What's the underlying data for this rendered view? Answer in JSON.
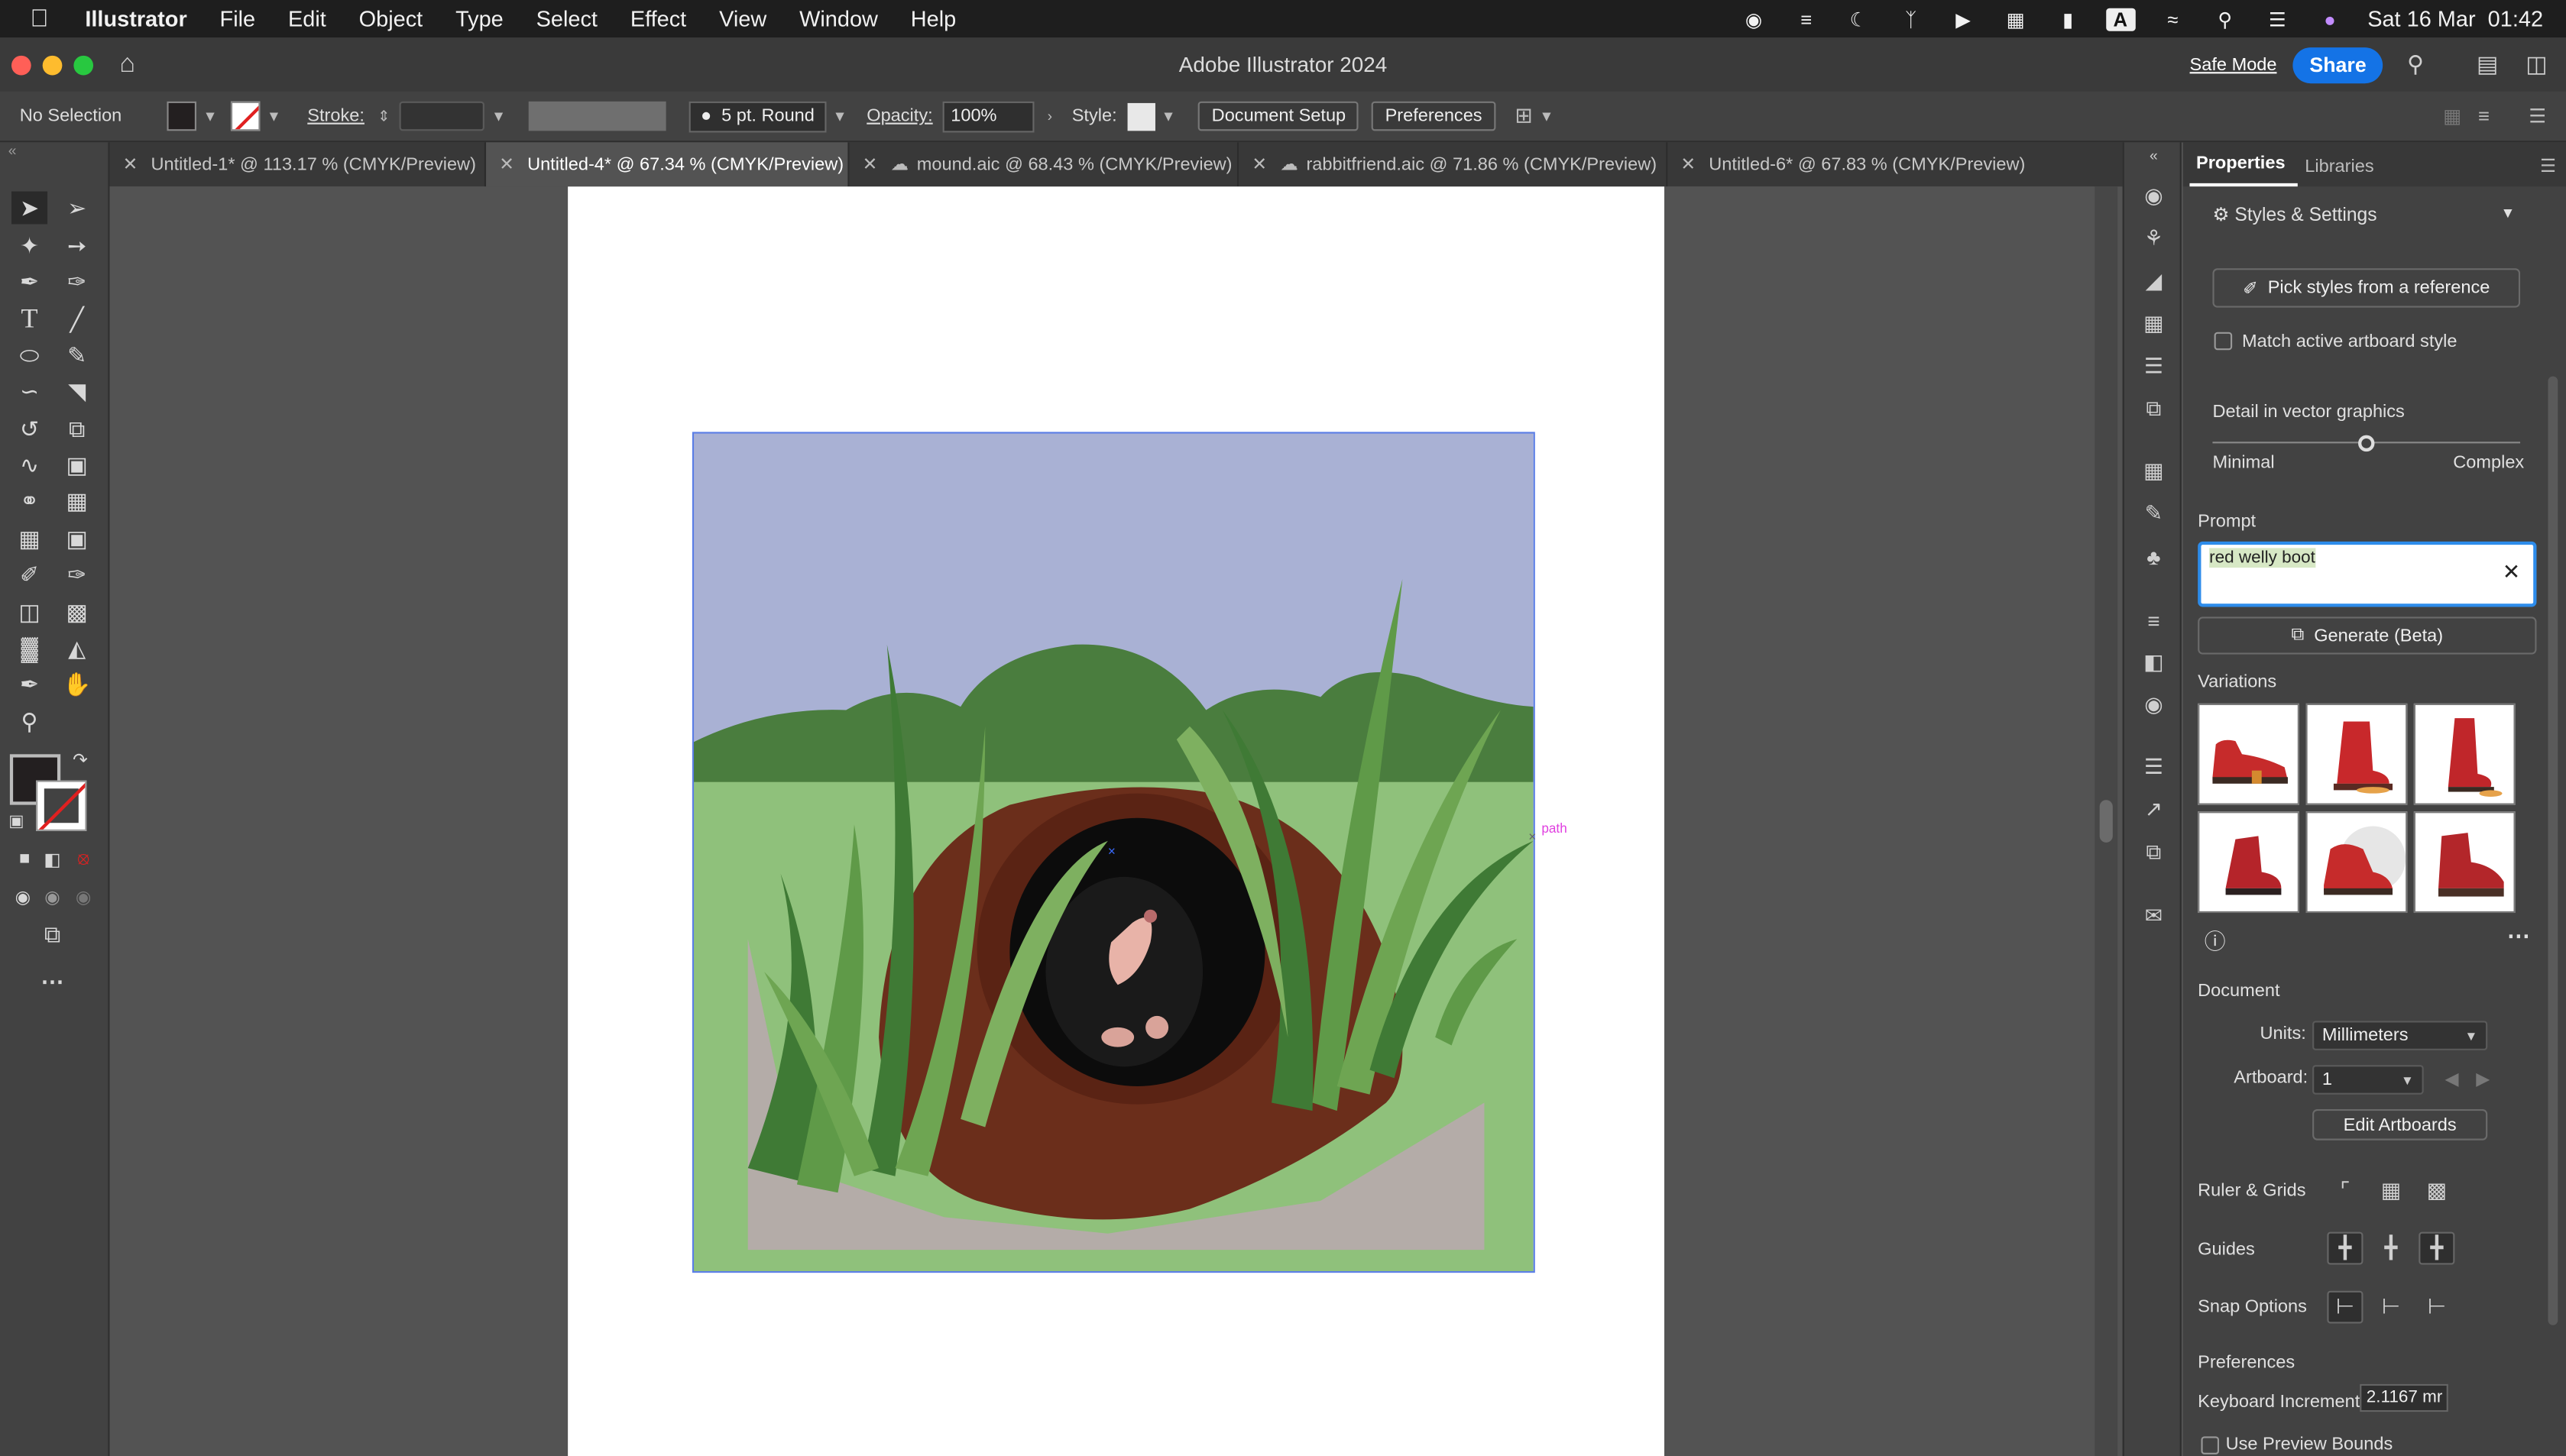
{
  "menubar": {
    "app_name": "Illustrator",
    "items": [
      "File",
      "Edit",
      "Object",
      "Type",
      "Select",
      "Effect",
      "View",
      "Window",
      "Help"
    ],
    "datetime": "Sat 16 Mar  01:42",
    "status_icons": [
      "creative-cloud-icon",
      "drive-icon",
      "moon-icon",
      "bluetooth-icon",
      "play-icon",
      "memory-icon",
      "battery-icon",
      "text-input-icon",
      "wifi-icon",
      "search-icon",
      "control-center-icon",
      "siri-icon"
    ]
  },
  "titlebar": {
    "title": "Adobe Illustrator 2024",
    "safe_mode": "Safe Mode",
    "share": "Share"
  },
  "controlbar": {
    "selection": "No Selection",
    "stroke_label": "Stroke:",
    "brush": "5 pt. Round",
    "opacity_label": "Opacity:",
    "opacity_value": "100%",
    "style_label": "Style:",
    "document_setup": "Document Setup",
    "preferences": "Preferences"
  },
  "tabs": [
    {
      "label": "Untitled-1* @ 113.17 % (CMYK/Preview)",
      "cloud": false,
      "active": false
    },
    {
      "label": "Untitled-4* @ 67.34 % (CMYK/Preview)",
      "cloud": false,
      "active": true
    },
    {
      "label": "mound.aic @ 68.43 % (CMYK/Preview)",
      "cloud": true,
      "active": false
    },
    {
      "label": "rabbitfriend.aic @ 71.86 % (CMYK/Preview)",
      "cloud": true,
      "active": false
    },
    {
      "label": "Untitled-6* @ 67.83 % (CMYK/Preview)",
      "cloud": false,
      "active": false
    }
  ],
  "canvas": {
    "path_hint": "path"
  },
  "panel": {
    "tab_properties": "Properties",
    "tab_libraries": "Libraries",
    "styles_settings": "Styles & Settings",
    "pick_styles": "Pick styles from a reference",
    "match_artboard": "Match active artboard style",
    "detail_label": "Detail in vector graphics",
    "detail_min": "Minimal",
    "detail_max": "Complex",
    "detail_level": 0.5,
    "prompt_label": "Prompt",
    "prompt_value": "red welly boot",
    "generate": "Generate (Beta)",
    "variations_label": "Variations",
    "document_label": "Document",
    "units_label": "Units:",
    "units_value": "Millimeters",
    "artboard_label": "Artboard:",
    "artboard_value": "1",
    "edit_artboards": "Edit Artboards",
    "ruler_grids": "Ruler & Grids",
    "guides": "Guides",
    "snap_options": "Snap Options",
    "preferences_label": "Preferences",
    "keyboard_increment_label": "Keyboard Increment:",
    "keyboard_increment_value": "2.1167 mr",
    "use_preview_bounds": "Use Preview Bounds"
  },
  "colors": {
    "accent": "#1473e6",
    "sky": "#a9b1d4",
    "hills": "#4a7d3e",
    "grass": "#8fc17b",
    "mound": "#6b2e1b",
    "ground": "#b4aca8"
  }
}
